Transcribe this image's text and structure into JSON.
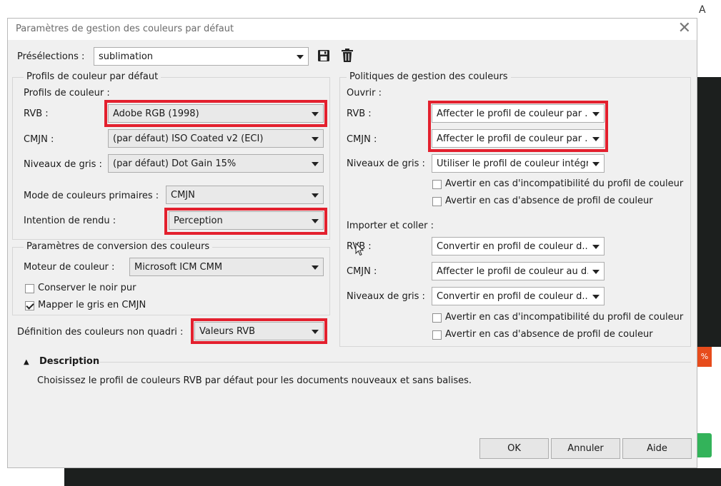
{
  "background": {
    "letter": "A",
    "chip": "%"
  },
  "dialog": {
    "title": "Paramètres de gestion des couleurs par défaut",
    "close_glyph": "✕",
    "presets": {
      "label": "Présélections :",
      "value": "sublimation"
    },
    "default_profiles": {
      "legend": "Profils de couleur par défaut",
      "sublabel": "Profils de couleur :",
      "rgb_label": "RVB :",
      "rgb_value": "Adobe RGB (1998)",
      "cmyk_label": "CMJN :",
      "cmyk_value": "(par défaut) ISO Coated v2 (ECI)",
      "gray_label": "Niveaux de gris :",
      "gray_value": "(par défaut) Dot Gain 15%",
      "primary_mode_label": "Mode de couleurs primaires :",
      "primary_mode_value": "CMJN",
      "intent_label": "Intention de rendu :",
      "intent_value": "Perception"
    },
    "conversion": {
      "legend": "Paramètres de conversion des couleurs",
      "engine_label": "Moteur de couleur :",
      "engine_value": "Microsoft ICM CMM",
      "keep_black_label": "Conserver le noir pur",
      "keep_black_checked": false,
      "map_gray_label": "Mapper le gris en CMJN",
      "map_gray_checked": true
    },
    "spot": {
      "label": "Définition des couleurs non quadri :",
      "value": "Valeurs RVB"
    },
    "policies": {
      "legend": "Politiques de gestion des couleurs",
      "open_label": "Ouvrir :",
      "open_rgb_label": "RVB :",
      "open_rgb_value": "Affecter le profil de couleur par ...",
      "open_cmyk_label": "CMJN :",
      "open_cmyk_value": "Affecter le profil de couleur par ...",
      "open_gray_label": "Niveaux de gris :",
      "open_gray_value": "Utiliser le profil de couleur intégré",
      "open_warn_mismatch": "Avertir en cas d'incompatibilité du profil de couleur",
      "open_warn_missing": "Avertir en cas d'absence de profil de couleur",
      "import_label": "Importer et coller :",
      "import_rgb_label": "RVB :",
      "import_rgb_value": "Convertir en profil de couleur d...",
      "import_cmyk_label": "CMJN :",
      "import_cmyk_value": "Affecter le profil de couleur au d...",
      "import_gray_label": "Niveaux de gris :",
      "import_gray_value": "Convertir en profil de couleur d...",
      "import_warn_mismatch": "Avertir en cas d'incompatibilité du profil de couleur",
      "import_warn_missing": "Avertir en cas d'absence de profil de couleur"
    },
    "description": {
      "toggle_glyph": "▲",
      "title": "Description",
      "text": "Choisissez le profil de couleurs RVB par défaut pour les documents nouveaux et sans balises."
    },
    "buttons": {
      "ok": "OK",
      "cancel": "Annuler",
      "help": "Aide"
    },
    "colors": {
      "highlight": "#e3202e",
      "dialog_bg": "#f0f0f0"
    }
  }
}
